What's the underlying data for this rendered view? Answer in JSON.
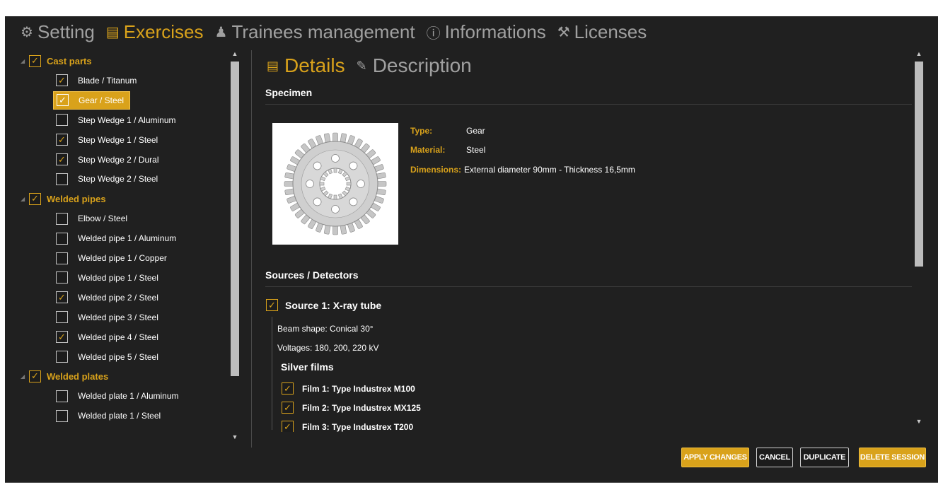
{
  "nav": {
    "items": [
      {
        "label": "Setting",
        "icon": "gear-icon",
        "glyph": "⚙"
      },
      {
        "label": "Exercises",
        "icon": "book-icon",
        "glyph": "▤"
      },
      {
        "label": "Trainees management",
        "icon": "user-icon",
        "glyph": "♟"
      },
      {
        "label": "Informations",
        "icon": "info-icon",
        "glyph": "ⓘ"
      },
      {
        "label": "Licenses",
        "icon": "wrench-icon",
        "glyph": "⚒"
      }
    ],
    "active": "Exercises"
  },
  "tree": {
    "groups": [
      {
        "label": "Cast parts",
        "checked": true,
        "items": [
          {
            "label": "Blade / Titanum",
            "checked": true
          },
          {
            "label": "Gear / Steel",
            "checked": true,
            "selected": true
          },
          {
            "label": "Step Wedge 1 / Aluminum",
            "checked": false
          },
          {
            "label": "Step Wedge 1 / Steel",
            "checked": true
          },
          {
            "label": "Step Wedge 2 / Dural",
            "checked": true
          },
          {
            "label": "Step Wedge 2 / Steel",
            "checked": false
          }
        ]
      },
      {
        "label": "Welded pipes",
        "checked": true,
        "items": [
          {
            "label": "Elbow / Steel",
            "checked": false
          },
          {
            "label": "Welded pipe 1 / Aluminum",
            "checked": false
          },
          {
            "label": "Welded pipe 1 / Copper",
            "checked": false
          },
          {
            "label": "Welded pipe 1 / Steel",
            "checked": false
          },
          {
            "label": "Welded pipe 2 / Steel",
            "checked": true
          },
          {
            "label": "Welded pipe 3 / Steel",
            "checked": false
          },
          {
            "label": "Welded pipe 4 / Steel",
            "checked": true
          },
          {
            "label": "Welded pipe 5 / Steel",
            "checked": false
          }
        ]
      },
      {
        "label": "Welded plates",
        "checked": true,
        "items": [
          {
            "label": "Welded plate 1 / Aluminum",
            "checked": false
          },
          {
            "label": "Welded plate 1 / Steel",
            "checked": false
          }
        ]
      }
    ]
  },
  "details": {
    "tabs": [
      {
        "label": "Details",
        "icon": "details-icon",
        "glyph": "▤"
      },
      {
        "label": "Description",
        "icon": "pencil-icon",
        "glyph": "✎"
      }
    ],
    "specimen_title": "Specimen",
    "type_label": "Type:",
    "type_value": "Gear",
    "material_label": "Material:",
    "material_value": "Steel",
    "dimensions_label": "Dimensions:",
    "dimensions_value": "External diameter 90mm - Thickness 16,5mm",
    "sources_title": "Sources / Detectors",
    "source_label": "Source 1: X-ray tube",
    "beam_shape": "Beam shape: Conical 30°",
    "voltages": "Voltages: 180, 200, 220 kV",
    "films_title": "Silver films",
    "films": [
      {
        "label": "Film 1: Type Industrex M100",
        "checked": true
      },
      {
        "label": "Film 2: Type Industrex MX125",
        "checked": true
      },
      {
        "label": "Film 3: Type Industrex T200",
        "checked": true
      }
    ]
  },
  "buttons": {
    "apply": "APPLY CHANGES",
    "cancel": "CANCEL",
    "duplicate": "DUPLICATE",
    "delete": "DELETE SESSION"
  },
  "colors": {
    "accent": "#d9a21b",
    "background": "#202020"
  }
}
